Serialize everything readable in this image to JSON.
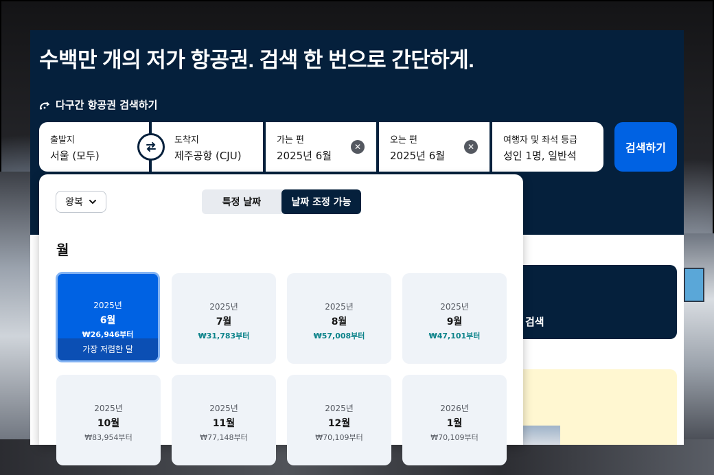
{
  "hero": {
    "headline": "수백만 개의 저가 항공권. 검색 한 번으로 간단하게.",
    "multi_city_link": "다구간 항공권 검색하기"
  },
  "search": {
    "from_label": "출발지",
    "from_value": "서울 (모두)",
    "to_label": "도착지",
    "to_value": "제주공항 (CJU)",
    "depart_label": "가는 편",
    "depart_value": "2025년 6월",
    "return_label": "오는 편",
    "return_value": "2025년 6월",
    "pax_label": "여행자 및 좌석 등급",
    "pax_value": "성인 1명, 일반석",
    "search_button": "검색하기"
  },
  "side": {
    "promo_text": "검색"
  },
  "picker": {
    "trip_type": "왕복",
    "tab_specific": "특정 날짜",
    "tab_flexible": "날짜 조정 가능",
    "section_title": "월",
    "months": [
      {
        "year": "2025년",
        "month": "6월",
        "price": "₩26,946부터",
        "badge": "가장 저렴한 달"
      },
      {
        "year": "2025년",
        "month": "7월",
        "price": "₩31,783부터"
      },
      {
        "year": "2025년",
        "month": "8월",
        "price": "₩57,008부터"
      },
      {
        "year": "2025년",
        "month": "9월",
        "price": "₩47,101부터"
      },
      {
        "year": "2025년",
        "month": "10월",
        "price": "₩83,954부터"
      },
      {
        "year": "2025년",
        "month": "11월",
        "price": "₩77,148부터"
      },
      {
        "year": "2025년",
        "month": "12월",
        "price": "₩70,109부터"
      },
      {
        "year": "2026년",
        "month": "1월",
        "price": "₩70,109부터"
      }
    ]
  },
  "colors": {
    "navy": "#05203c",
    "primary_blue": "#0062e3",
    "price_teal": "#0c838a"
  }
}
